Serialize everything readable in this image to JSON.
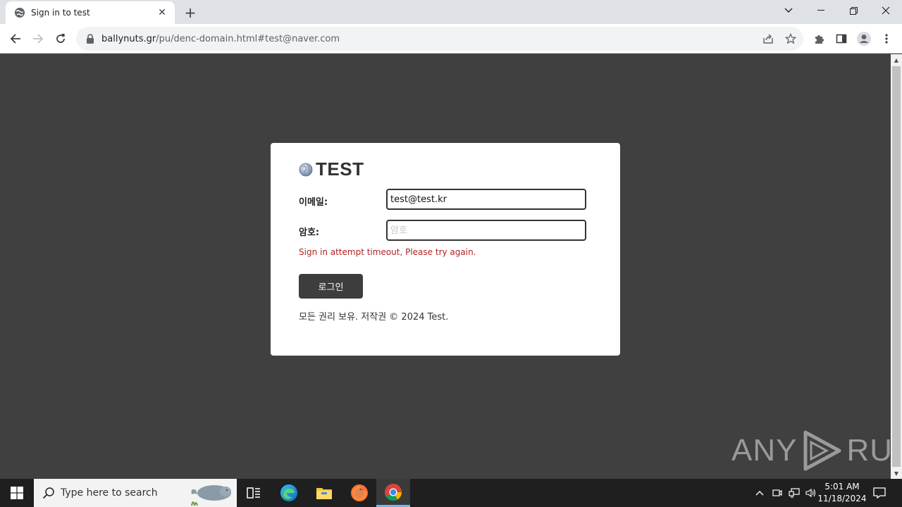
{
  "browser": {
    "tab_title": "Sign in to test",
    "new_tab_symbol": "+",
    "url_host": "ballynuts.gr",
    "url_path": "/pu/denc-domain.html#test@naver.com"
  },
  "page": {
    "brand_name": "TEST",
    "email_label": "이메일:",
    "email_value": "test@test.kr",
    "password_label": "암호:",
    "password_placeholder": "암호",
    "error_message": "Sign in attempt timeout, Please try again.",
    "login_button": "로그인",
    "footer": "모든 권리 보유. 저작권 © 2024 Test."
  },
  "watermark": {
    "left": "ANY",
    "right": "RUN"
  },
  "taskbar": {
    "search_placeholder": "Type here to search",
    "time": "5:01 AM",
    "date": "11/18/2024"
  },
  "colors": {
    "page_background": "#404040",
    "error": "#b22222",
    "button": "#3d3d3d",
    "taskbar": "#1f1f1f"
  }
}
